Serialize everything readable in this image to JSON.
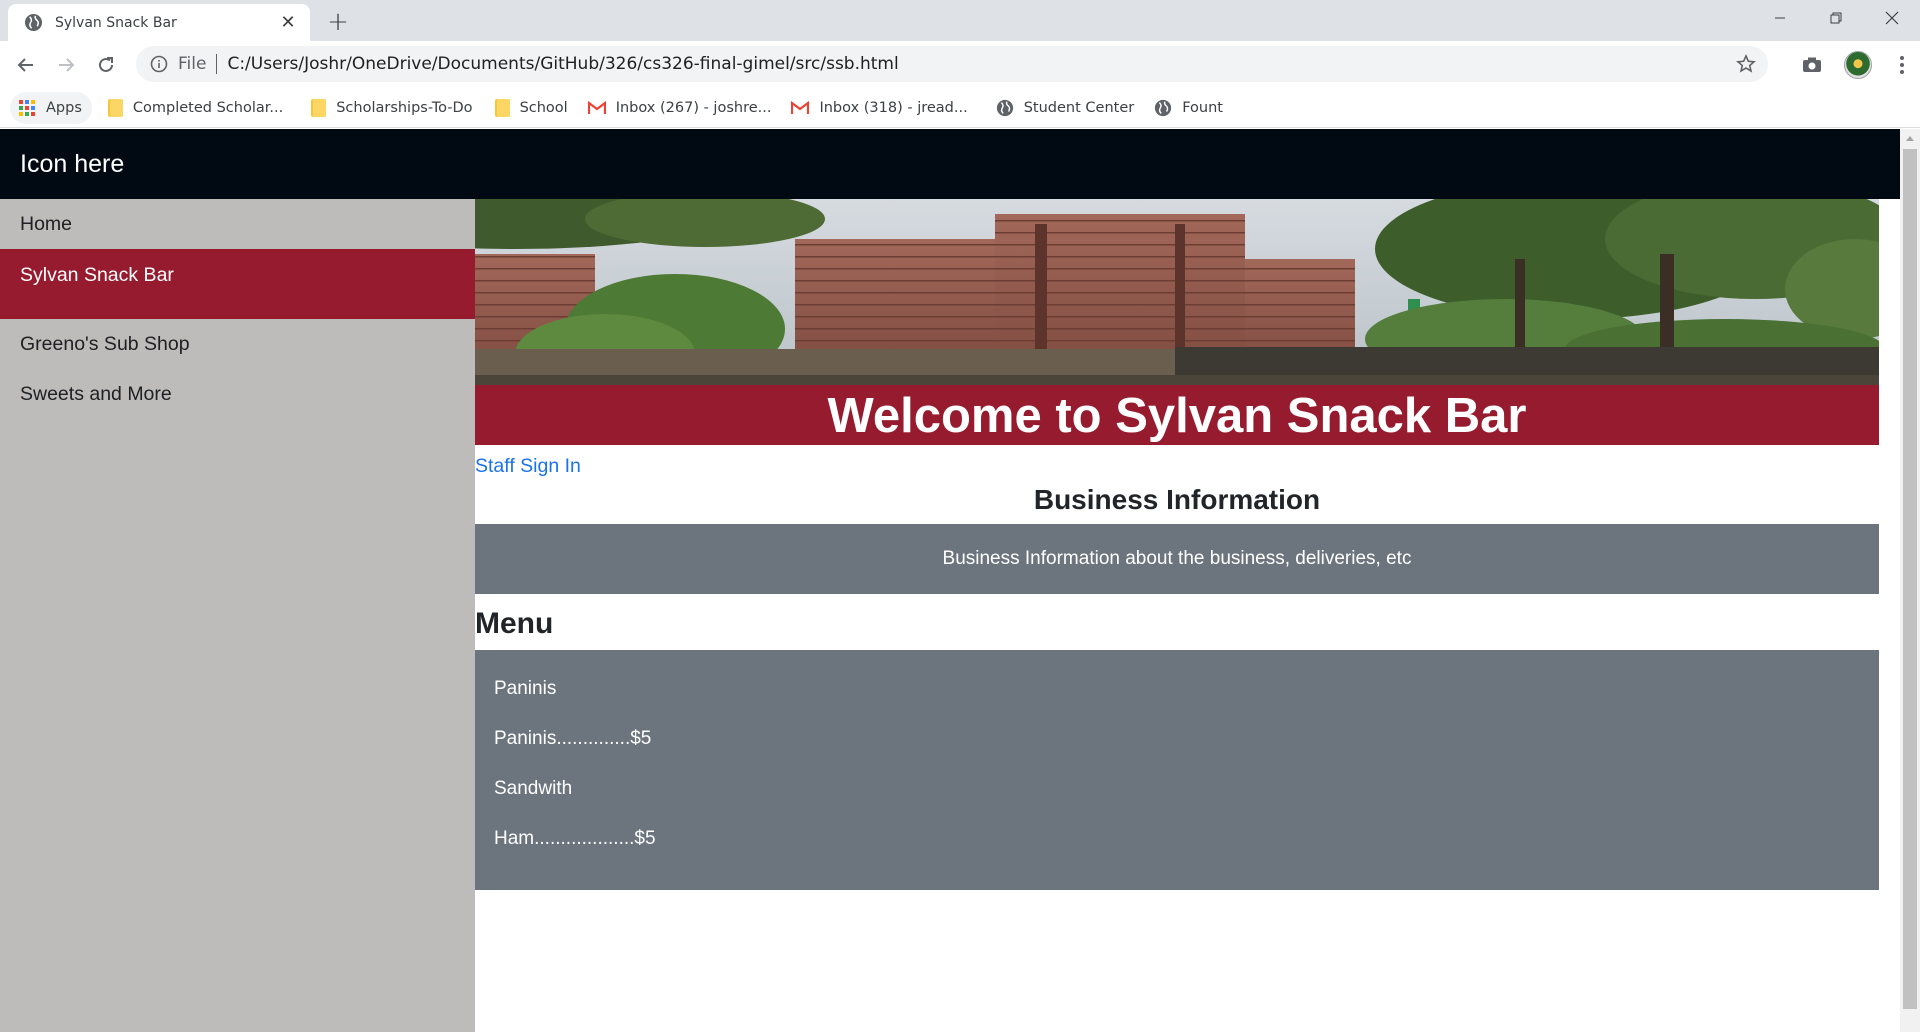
{
  "browser": {
    "tab_title": "Sylvan Snack Bar",
    "address_scheme": "File",
    "address_url": "C:/Users/Joshr/OneDrive/Documents/GitHub/326/cs326-final-gimel/src/ssb.html",
    "bookmarks": [
      {
        "label": "Apps",
        "icon": "apps-grid-icon"
      },
      {
        "label": "Completed Scholar...",
        "icon": "folder-icon"
      },
      {
        "label": "Scholarships-To-Do",
        "icon": "folder-icon"
      },
      {
        "label": "School",
        "icon": "folder-icon"
      },
      {
        "label": "Inbox (267) - joshre...",
        "icon": "gmail-icon"
      },
      {
        "label": "Inbox (318) - jread...",
        "icon": "gmail-icon"
      },
      {
        "label": "Student Center",
        "icon": "globe-icon"
      },
      {
        "label": "Fount",
        "icon": "globe-icon"
      }
    ]
  },
  "page": {
    "brand": "Icon here",
    "sidebar": {
      "items": [
        {
          "label": "Home"
        },
        {
          "label": "Sylvan Snack Bar"
        },
        {
          "label": "Greeno's Sub Shop"
        },
        {
          "label": "Sweets and More"
        }
      ]
    },
    "welcome": "Welcome to Sylvan Snack Bar",
    "staff_link": "Staff Sign In",
    "business_title": "Business Information",
    "business_text": "Business Information about the business, deliveries, etc",
    "menu_title": "Menu",
    "menu_lines": [
      "Paninis",
      "Paninis..............$5",
      "Sandwith",
      "Ham...................$5"
    ]
  },
  "colors": {
    "navbar": "#010a13",
    "accent": "#971b2f",
    "sidebar": "#bdbcba",
    "panel": "#6c757d",
    "link": "#1a73e8"
  }
}
